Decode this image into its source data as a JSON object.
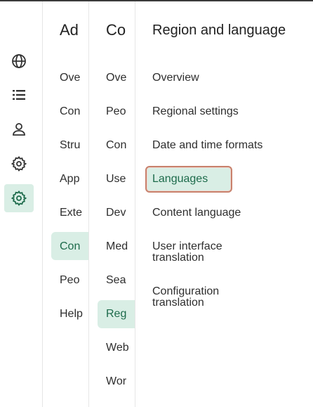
{
  "colors": {
    "accent": "#1d6b4b",
    "highlight": "#d9eee5",
    "focus_border": "#c8816c"
  },
  "rail": {
    "icons": [
      {
        "name": "globe-icon",
        "active": false
      },
      {
        "name": "list-icon",
        "active": false
      },
      {
        "name": "person-icon",
        "active": false
      },
      {
        "name": "gear-icon",
        "active": false
      },
      {
        "name": "gear-icon",
        "active": true
      }
    ]
  },
  "col1": {
    "title": "Ad",
    "items": [
      "Ove",
      "Con",
      "Stru",
      "App",
      "Exte",
      "Con",
      "Peo",
      "Help"
    ],
    "active_index": 5
  },
  "col2": {
    "title": "Co",
    "items": [
      "Ove",
      "Peo",
      "Con",
      "Use",
      "Dev",
      "Med",
      "Sea",
      "Reg",
      "Web",
      "Wor"
    ],
    "active_index": 7
  },
  "col3": {
    "title": "Region and language",
    "items": [
      "Overview",
      "Regional settings",
      "Date and time formats",
      "Languages",
      "Content language",
      "User interface translation",
      "Configuration translation"
    ],
    "active_index": 3
  }
}
